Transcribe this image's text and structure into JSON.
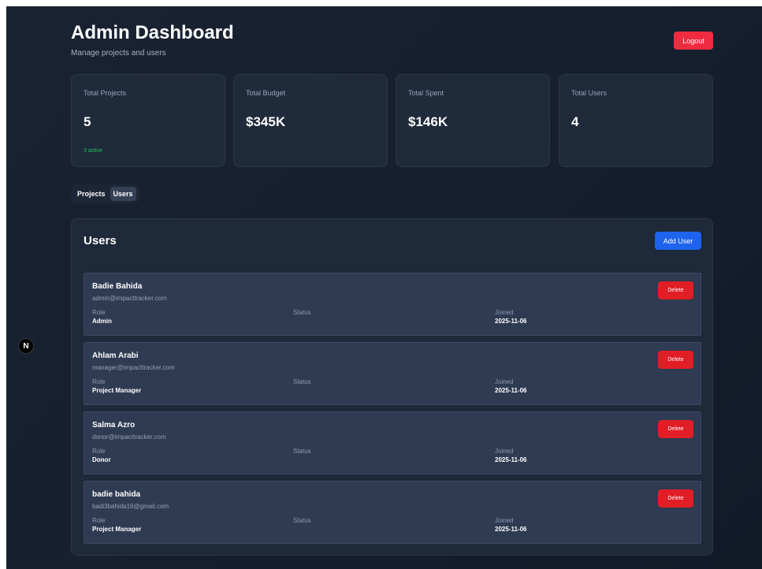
{
  "header": {
    "title": "Admin Dashboard",
    "subtitle": "Manage projects and users",
    "logout_label": "Logout"
  },
  "stats": [
    {
      "label": "Total Projects",
      "value": "5",
      "sub": "3 active"
    },
    {
      "label": "Total Budget",
      "value": "$345K",
      "sub": ""
    },
    {
      "label": "Total Spent",
      "value": "$146K",
      "sub": ""
    },
    {
      "label": "Total Users",
      "value": "4",
      "sub": ""
    }
  ],
  "tabs": [
    {
      "label": "Projects",
      "active": false
    },
    {
      "label": "Users",
      "active": true
    }
  ],
  "users_panel": {
    "title": "Users",
    "add_label": "Add User",
    "role_label": "Role",
    "status_label": "Status",
    "joined_label": "Joined",
    "delete_label": "Delete",
    "users": [
      {
        "name": "Badie Bahida",
        "email": "admin@impacttracker.com",
        "role": "Admin",
        "status": "",
        "joined": "2025-11-06"
      },
      {
        "name": "Ahlam Arabi",
        "email": "manager@impacttracker.com",
        "role": "Project Manager",
        "status": "",
        "joined": "2025-11-06"
      },
      {
        "name": "Salma Azro",
        "email": "donor@impacttracker.com",
        "role": "Donor",
        "status": "",
        "joined": "2025-11-06"
      },
      {
        "name": "badie bahida",
        "email": "badi3bahida16@gmail.com",
        "role": "Project Manager",
        "status": "",
        "joined": "2025-11-06"
      }
    ]
  },
  "dev_badge": {
    "label": "N"
  }
}
